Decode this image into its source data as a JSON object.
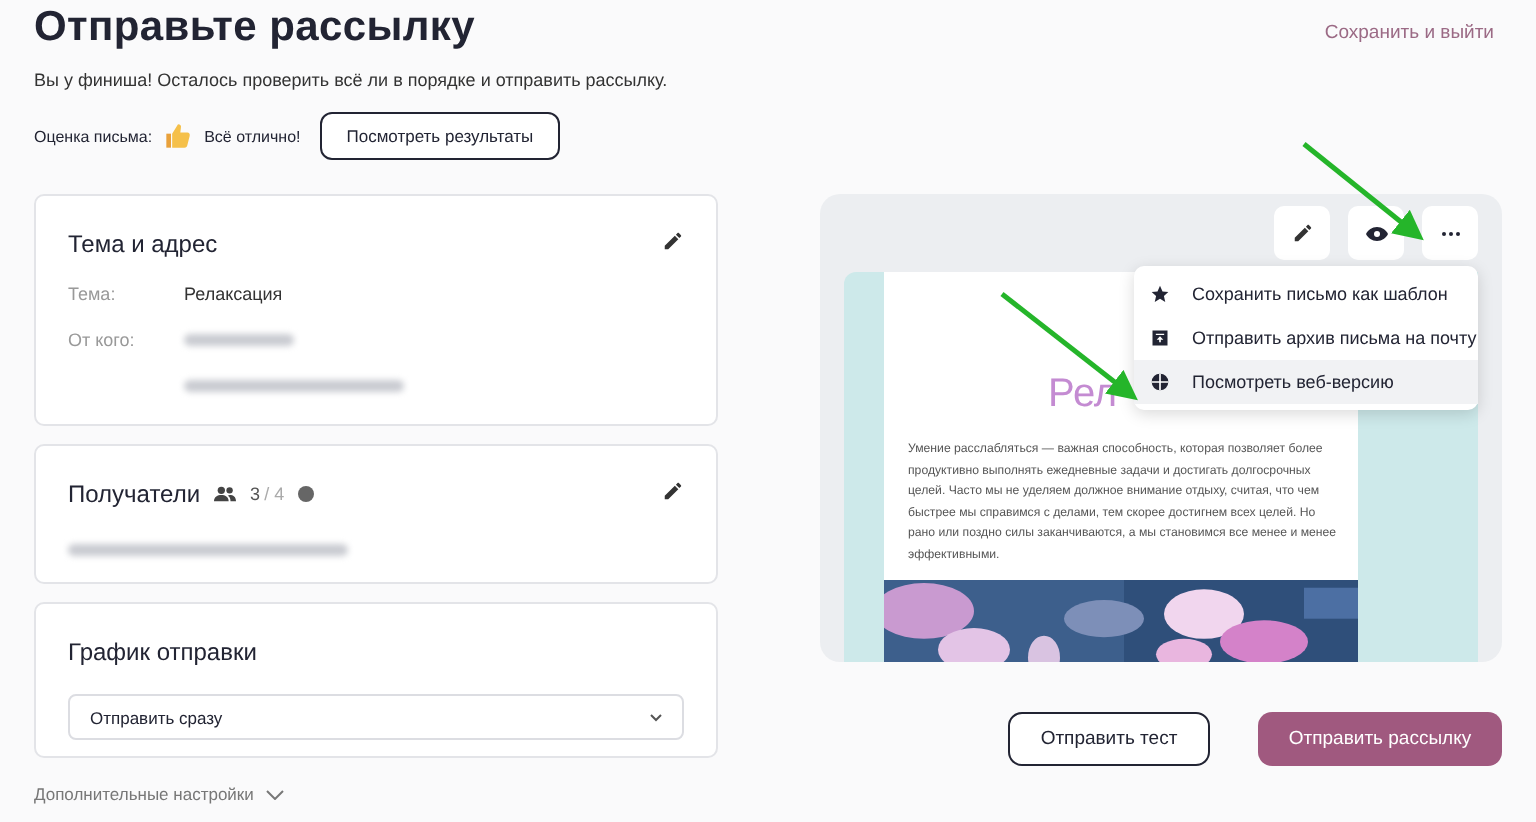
{
  "header": {
    "title": "Отправьте рассылку",
    "save_exit": "Сохранить и выйти",
    "subtitle": "Вы у финиша! Осталось проверить всё ли в порядке и отправить рассылку."
  },
  "rating": {
    "label": "Оценка письма:",
    "verdict": "Всё отлично!",
    "button": "Посмотреть результаты"
  },
  "subject_card": {
    "title": "Тема и адрес",
    "fields": [
      {
        "label": "Тема:",
        "value": "Релаксация",
        "redacted": false
      },
      {
        "label": "От кого:",
        "redacted": true
      },
      {
        "redacted": true
      }
    ]
  },
  "recipients_card": {
    "title": "Получатели",
    "count": "3",
    "total": "/ 4",
    "redacted_list": true
  },
  "schedule_card": {
    "title": "График отправки",
    "select_value": "Отправить сразу"
  },
  "more_settings": "Дополнительные настройки",
  "preview": {
    "heading": "Рел",
    "body": "Умение расслабляться — важная способность, которая позволяет более продуктивно выполнять ежедневные задачи и достигать долгосрочных целей. Часто мы не уделяем должное внимание отдыху, считая, что чем быстрее мы справимся с делами, тем скорее достигнем всех целей. Но рано или поздно силы заканчиваются, а мы становимся все менее и менее эффективными.",
    "menu": [
      {
        "kind": "star",
        "label": "Сохранить письмо как шаблон",
        "selected": false
      },
      {
        "kind": "archive",
        "label": "Отправить архив письма на почту",
        "selected": false
      },
      {
        "kind": "globe",
        "label": "Посмотреть веб-версию",
        "selected": true
      }
    ]
  },
  "actions": {
    "test": "Отправить тест",
    "send": "Отправить рассылку"
  }
}
